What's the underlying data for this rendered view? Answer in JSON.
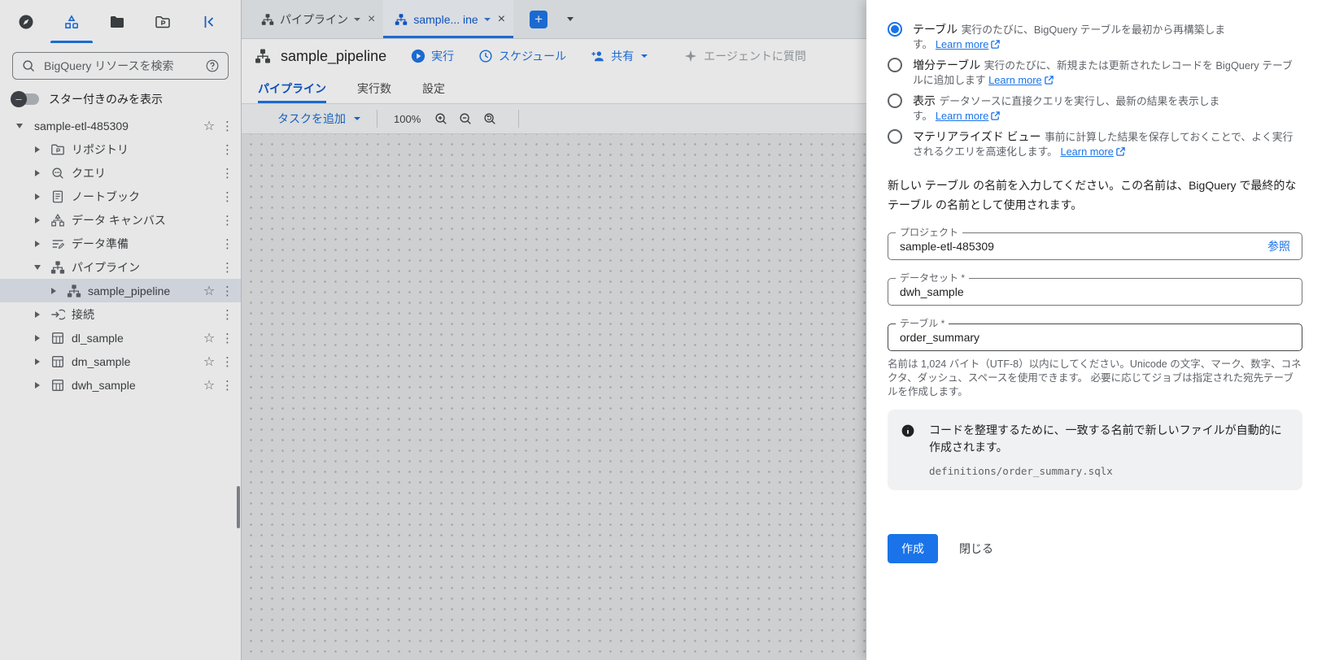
{
  "colors": {
    "accent": "#1a73e8"
  },
  "sidebar": {
    "search": {
      "placeholder": "BigQuery リソースを検索"
    },
    "filter_toggle": {
      "label": "スター付きのみを表示",
      "state": "off"
    },
    "tree": [
      {
        "label": "sample-etl-485309",
        "icon": "project-root",
        "level": 0,
        "expanded": true,
        "starred": true
      },
      {
        "label": "リポジトリ",
        "icon": "repository-icon",
        "level": 1
      },
      {
        "label": "クエリ",
        "icon": "query-icon",
        "level": 1
      },
      {
        "label": "ノートブック",
        "icon": "notebook-icon",
        "level": 1
      },
      {
        "label": "データ キャンバス",
        "icon": "data-canvas-icon",
        "level": 1
      },
      {
        "label": "データ準備",
        "icon": "data-prep-icon",
        "level": 1
      },
      {
        "label": "パイプライン",
        "icon": "pipeline-icon",
        "level": 1,
        "expanded": true
      },
      {
        "label": "sample_pipeline",
        "icon": "pipeline-icon",
        "level": 2,
        "selected": true,
        "starred": true
      },
      {
        "label": "接続",
        "icon": "connection-icon",
        "level": 1
      },
      {
        "label": "dl_sample",
        "icon": "table-icon",
        "level": 1,
        "starred": true
      },
      {
        "label": "dm_sample",
        "icon": "table-icon",
        "level": 1,
        "starred": true
      },
      {
        "label": "dwh_sample",
        "icon": "table-icon",
        "level": 1,
        "starred": true
      }
    ]
  },
  "tabbar": {
    "tabs": [
      {
        "label": "パイプライン",
        "active": false
      },
      {
        "label": "sample... ine",
        "active": true
      }
    ]
  },
  "doc": {
    "title": "sample_pipeline",
    "actions": {
      "run": "実行",
      "schedule": "スケジュール",
      "share": "共有",
      "ask_agent": "エージェントに質問"
    },
    "subtabs": [
      {
        "label": "パイプライン",
        "active": true
      },
      {
        "label": "実行数",
        "active": false
      },
      {
        "label": "設定",
        "active": false
      }
    ],
    "toolbar": {
      "add_task": "タスクを追加",
      "zoom_level": "100%"
    }
  },
  "dialog": {
    "options": [
      {
        "label": "テーブル",
        "desc": "実行のたびに、BigQuery テーブルを最初から再構築します。",
        "link": "Learn more",
        "selected": true
      },
      {
        "label": "増分テーブル",
        "desc": "実行のたびに、新規または更新されたレコードを BigQuery テーブルに追加します",
        "link": "Learn more",
        "selected": false
      },
      {
        "label": "表示",
        "desc": "データソースに直接クエリを実行し、最新の結果を表示します。",
        "link": "Learn more",
        "selected": false
      },
      {
        "label": "マテリアライズド ビュー",
        "desc": "事前に計算した結果を保存しておくことで、よく実行されるクエリを高速化します。",
        "link": "Learn more",
        "selected": false
      }
    ],
    "intro": "新しい テーブル の名前を入力してください。この名前は、BigQuery で最終的なテーブル の名前として使用されます。",
    "fields": [
      {
        "label": "プロジェクト",
        "value": "sample-etl-485309",
        "action": "参照"
      },
      {
        "label": "データセット *",
        "value": "dwh_sample",
        "action": ""
      },
      {
        "label": "テーブル *",
        "value": "order_summary",
        "action": ""
      }
    ],
    "helper": "名前は 1,024 バイト（UTF-8）以内にしてください。Unicode の文字、マーク、数字、コネクタ、ダッシュ、スペースを使用できます。 必要に応じてジョブは指定された宛先テーブルを作成します。",
    "note": {
      "text": "コードを整理するために、一致する名前で新しいファイルが自動的に作成されます。",
      "file": "definitions/order_summary.sqlx"
    },
    "actions": {
      "create": "作成",
      "close": "閉じる"
    }
  }
}
